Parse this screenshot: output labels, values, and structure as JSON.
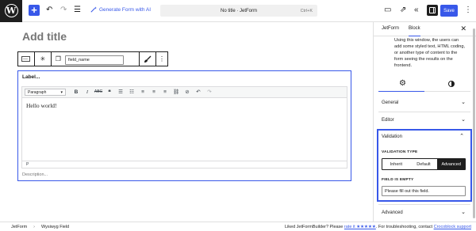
{
  "topbar": {
    "plus_label": "+",
    "generate_label": "Generate Form with AI",
    "doc_title": "No title · JetForm",
    "shortcut": "Ctrl+K",
    "save_label": "Save",
    "accent_color": "#3858e9"
  },
  "canvas": {
    "title_placeholder": "Add title",
    "field_name_value": "field_name",
    "label_placeholder": "Label...",
    "format_select": "Paragraph",
    "editor_content": "Hello world!",
    "editor_status": "P",
    "description_placeholder": "Description..."
  },
  "footer": {
    "breadcrumb": [
      "JetForm",
      "Wysiwyg Field"
    ],
    "credit_prefix": "Liked JetFormBuilder? Please",
    "credit_rate": "rate it ★★★★★",
    "credit_mid": ". For troubleshooting, contact",
    "credit_link": "Crocoblock support"
  },
  "sidebar": {
    "tabs": [
      "JetForm",
      "Block"
    ],
    "active_tab": "Block",
    "intro_text": "Using this window, the users can add some styled text, HTML coding, or another type of content to the form seeing the results on the frontend.",
    "panels": {
      "general": "General",
      "editor": "Editor",
      "validation": "Validation",
      "advanced": "Advanced"
    },
    "validation": {
      "type_label": "VALIDATION TYPE",
      "options": [
        "Inherit",
        "Default",
        "Advanced"
      ],
      "selected": "Advanced",
      "empty_label": "FIELD IS EMPTY",
      "empty_value": "Please fill out this field."
    }
  }
}
